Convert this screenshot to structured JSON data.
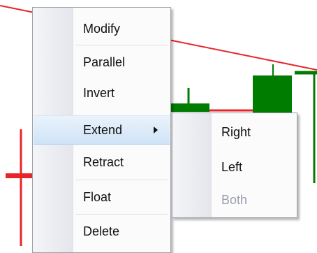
{
  "menu": {
    "items": [
      {
        "label": "Modify"
      },
      {
        "label": "Parallel"
      },
      {
        "label": "Invert"
      },
      {
        "label": "Extend",
        "has_submenu": true,
        "highlighted": true
      },
      {
        "label": "Retract"
      },
      {
        "label": "Float"
      },
      {
        "label": "Delete"
      }
    ]
  },
  "submenu": {
    "items": [
      {
        "label": "Right",
        "enabled": true
      },
      {
        "label": "Left",
        "enabled": true
      },
      {
        "label": "Both",
        "enabled": false
      }
    ]
  },
  "colors": {
    "trend_line": "#e8242a",
    "bull_candle": "#007c00",
    "bear_candle": "#e8242a",
    "highlight": "#cfe3f7",
    "disabled_text": "#9a9fb2"
  }
}
